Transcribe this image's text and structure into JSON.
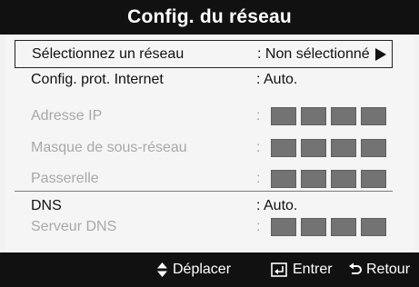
{
  "dialog": {
    "title": "Config. du réseau"
  },
  "rows": [
    {
      "label": "Sélectionnez un réseau",
      "value": ": Non sélectionné",
      "selected": true
    },
    {
      "label": "Config. prot. Internet",
      "value": ": Auto."
    },
    {
      "label": "Adresse IP",
      "value": ":",
      "disabled": true
    },
    {
      "label": "Masque de sous-réseau",
      "value": ":",
      "disabled": true
    },
    {
      "label": "Passerelle",
      "value": ":",
      "disabled": true
    },
    {
      "label": "DNS",
      "value": ": Auto."
    },
    {
      "label": "Serveur DNS",
      "value": ":",
      "disabled": true
    }
  ],
  "footer": {
    "move_label": "Déplacer",
    "enter_label": "Entrer",
    "return_label": "Retour"
  },
  "colors": {
    "bar_background": "#111111",
    "panel_background": "#f2f2f2",
    "disabled_text": "#a8a8a8",
    "field_box": "#737373"
  },
  "icons": {
    "selection_arrow": "triangle-right-icon",
    "move": "up-down-arrows-icon",
    "enter": "enter-key-icon",
    "return": "return-arrow-icon"
  }
}
